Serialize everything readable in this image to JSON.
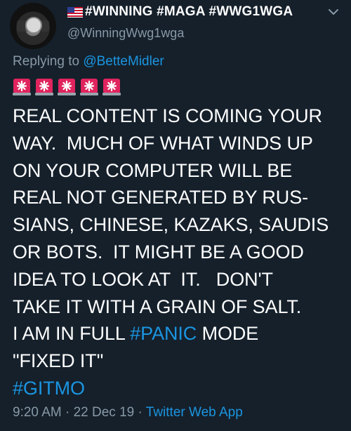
{
  "tweet": {
    "display_name": "#WINNING #MAGA #WWG1WGA",
    "handle": "@WinningWwg1wga",
    "replying_prefix": "Replying to ",
    "replying_to": "@BetteMidler",
    "siren_emoji_count": 5,
    "body_lines": [
      "REAL CONTENT IS COMING YOUR",
      "WAY.  MUCH OF WHAT WINDS UP",
      "ON YOUR COMPUTER WILL BE",
      "REAL NOT GENERATED BY RUS-",
      "SIANS, CHINESE, KAZAKS, SAUDIS",
      "OR BOTS.  IT MIGHT BE A GOOD",
      "IDEA TO LOOK AT  IT.   DON'T",
      "TAKE IT WITH A GRAIN OF SALT."
    ],
    "panic_prefix": "I AM IN FULL ",
    "panic_hashtag": "#PANIC",
    "panic_suffix": " MODE",
    "fixed_line": "\"FIXED IT\"",
    "gitmo_hashtag": "#GITMO",
    "time": "9:20 AM",
    "separator": " · ",
    "date": "22 Dec 19",
    "source_app": "Twitter Web App"
  },
  "colors": {
    "background": "#15202b",
    "link": "#1b95e0",
    "muted": "#8899a6",
    "siren_red": "#e0245e"
  },
  "icons": {
    "caret": "chevron-down-icon",
    "siren": "rotating-light-icon"
  }
}
